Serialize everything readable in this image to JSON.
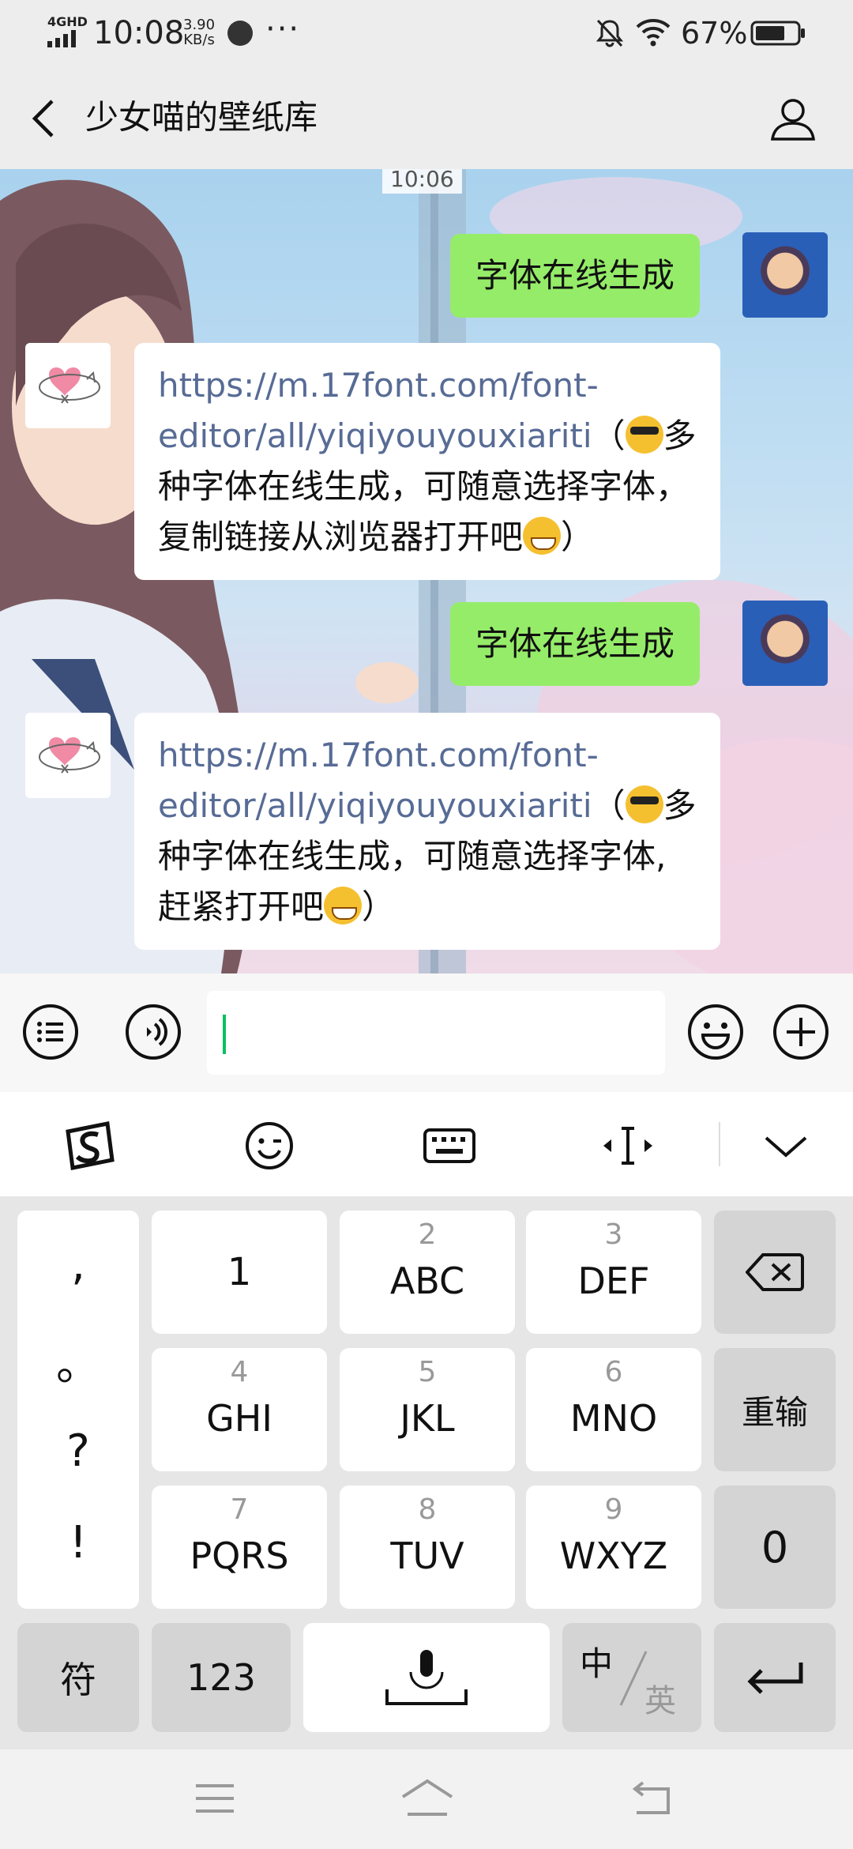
{
  "status_bar": {
    "network": "4GHD",
    "time": "10:08",
    "speed_value": "3.90",
    "speed_unit": "KB/s",
    "more": "···",
    "battery_percent": "67%"
  },
  "header": {
    "title": "少女喵的壁纸库"
  },
  "chat": {
    "timestamp": "10:06",
    "messages": [
      {
        "direction": "out",
        "text": "字体在线生成"
      },
      {
        "direction": "in",
        "link": "https://m.17font.com/font-editor/all/yiqiyouyouxiariti",
        "open_paren": "（",
        "text_a": "多种字体在线生成，可随意选择字体，复制链接从浏览器打开吧",
        "close_paren": "）"
      },
      {
        "direction": "out",
        "text": "字体在线生成"
      },
      {
        "direction": "in",
        "link": "https://m.17font.com/font-editor/all/yiqiyouyouxiariti",
        "open_paren": "（",
        "text_a": "多种字体在线生成，可随意选择字体,赶紧打开吧",
        "close_paren": "）"
      }
    ]
  },
  "input": {
    "value": ""
  },
  "keyboard": {
    "punctuation": [
      ",",
      "。",
      "?",
      "!"
    ],
    "keys": {
      "k1": {
        "num": "",
        "letters": "1"
      },
      "k2": {
        "num": "2",
        "letters": "ABC"
      },
      "k3": {
        "num": "3",
        "letters": "DEF"
      },
      "k4": {
        "num": "4",
        "letters": "GHI"
      },
      "k5": {
        "num": "5",
        "letters": "JKL"
      },
      "k6": {
        "num": "6",
        "letters": "MNO"
      },
      "k7": {
        "num": "7",
        "letters": "PQRS"
      },
      "k8": {
        "num": "8",
        "letters": "TUV"
      },
      "k9": {
        "num": "9",
        "letters": "WXYZ"
      }
    },
    "reinput": "重输",
    "zero": "0",
    "symbols": "符",
    "numbers": "123",
    "lang_zh": "中",
    "lang_en": "英"
  },
  "colors": {
    "accent": "#07c160",
    "bubble_out": "#95ec69",
    "link": "#576b95"
  }
}
